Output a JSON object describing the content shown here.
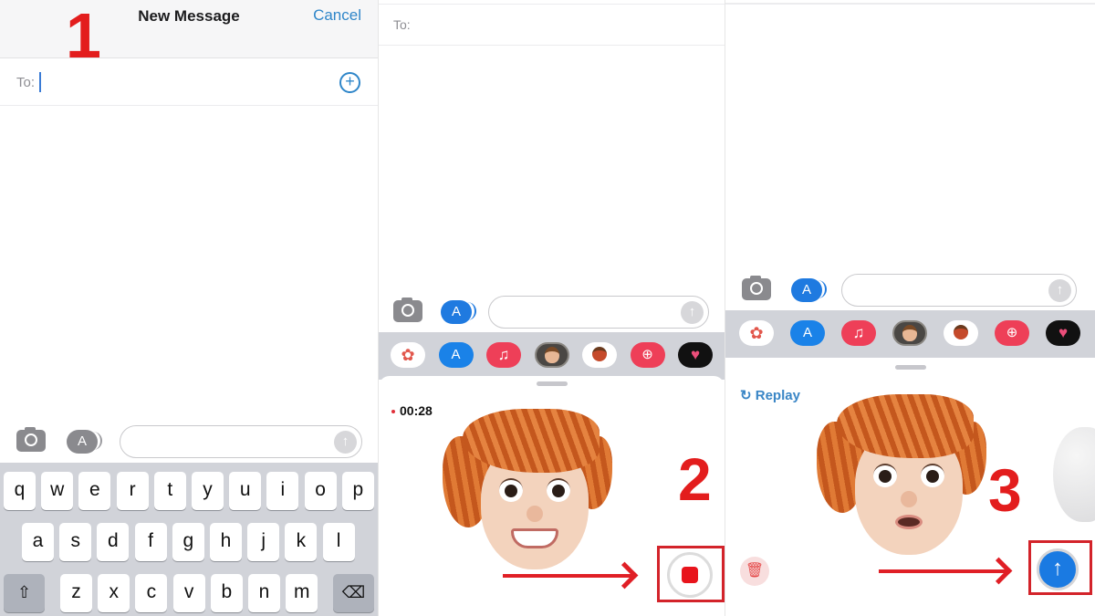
{
  "step1": {
    "step_number": "1",
    "header": {
      "title": "New Message",
      "cancel_label": "Cancel"
    },
    "to_label": "To:",
    "add_contact_icon": "+",
    "compose": {
      "camera_icon": "camera-icon",
      "apps_icon": "A",
      "message_placeholder": "",
      "send_icon": "↑"
    },
    "keyboard": {
      "row1": [
        "q",
        "w",
        "e",
        "r",
        "t",
        "y",
        "u",
        "i",
        "o",
        "p"
      ],
      "row2": [
        "a",
        "s",
        "d",
        "f",
        "g",
        "h",
        "j",
        "k",
        "l"
      ],
      "row3": [
        "z",
        "x",
        "c",
        "v",
        "b",
        "n",
        "m"
      ],
      "shift_icon": "⇧",
      "delete_icon": "⌫"
    }
  },
  "step2": {
    "step_number": "2",
    "to_label": "To:",
    "compose": {
      "apps_icon": "A",
      "send_icon": "↑"
    },
    "app_drawer": [
      {
        "name": "photos",
        "glyph": "✿"
      },
      {
        "name": "app-store",
        "glyph": "A"
      },
      {
        "name": "music",
        "glyph": "♫"
      },
      {
        "name": "memoji",
        "glyph": ""
      },
      {
        "name": "memoji-stickers",
        "glyph": ""
      },
      {
        "name": "images-search",
        "glyph": "⊕"
      },
      {
        "name": "digital-touch",
        "glyph": "♥"
      }
    ],
    "recording_timer": "00:28",
    "stop_button_label": "Stop recording"
  },
  "step3": {
    "step_number": "3",
    "compose": {
      "apps_icon": "A",
      "send_icon": "↑"
    },
    "app_drawer": [
      {
        "name": "photos",
        "glyph": "✿"
      },
      {
        "name": "app-store",
        "glyph": "A"
      },
      {
        "name": "music",
        "glyph": "♫"
      },
      {
        "name": "memoji",
        "glyph": ""
      },
      {
        "name": "memoji-stickers",
        "glyph": ""
      },
      {
        "name": "images-search",
        "glyph": "⊕"
      },
      {
        "name": "digital-touch",
        "glyph": "♥"
      }
    ],
    "replay_label": "Replay",
    "replay_icon": "↻",
    "trash_icon": "🗑",
    "send_icon": "↑"
  },
  "colors": {
    "annotation_red": "#e31d1d",
    "ios_blue": "#1a7ae2",
    "link_blue": "#2f86c9"
  }
}
